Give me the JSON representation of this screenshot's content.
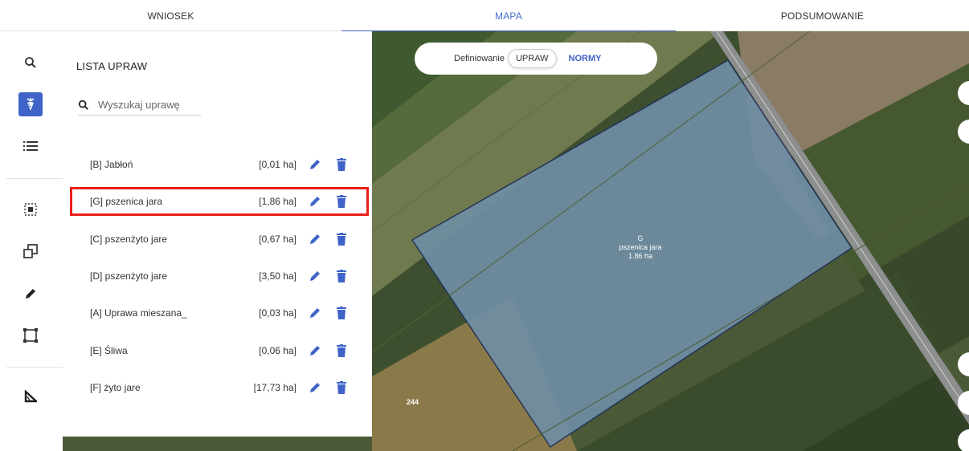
{
  "tabs": [
    {
      "label": "WNIOSEK"
    },
    {
      "label": "MAPA"
    },
    {
      "label": "PODSUMOWANIE"
    }
  ],
  "toolbar": {
    "items": [
      "search-icon",
      "crop-icon",
      "list-icon",
      "select-area-icon",
      "copy-shape-icon",
      "pencil-icon",
      "frame-icon",
      "measure-angle-icon"
    ]
  },
  "toggle": {
    "label": "Definiowanie",
    "option_selected": "UPRAW",
    "option_other": "NORMY"
  },
  "panel": {
    "title": "LISTA UPRAW",
    "search_placeholder": "Wyszukaj uprawę",
    "items": [
      {
        "name": "[B] Jabłoń",
        "area": "[0,01 ha]"
      },
      {
        "name": "[G] pszenica jara",
        "area": "[1,86 ha]"
      },
      {
        "name": "[C] pszenżyto jare",
        "area": "[0,67 ha]"
      },
      {
        "name": "[D] pszenżyto jare",
        "area": "[3,50 ha]"
      },
      {
        "name": "[A] Uprawa mieszana_",
        "area": "[0,03 ha]"
      },
      {
        "name": "[E] Śliwa",
        "area": "[0,06 ha]"
      },
      {
        "name": "[F] żyto jare",
        "area": "[17,73 ha]"
      }
    ]
  },
  "map": {
    "parcel_code": "G",
    "parcel_crop": "pszenica jara",
    "parcel_area": "1.86 ha",
    "number_label": "244"
  },
  "colors": {
    "accent": "#3f63c8",
    "highlight": "#e8201a"
  }
}
